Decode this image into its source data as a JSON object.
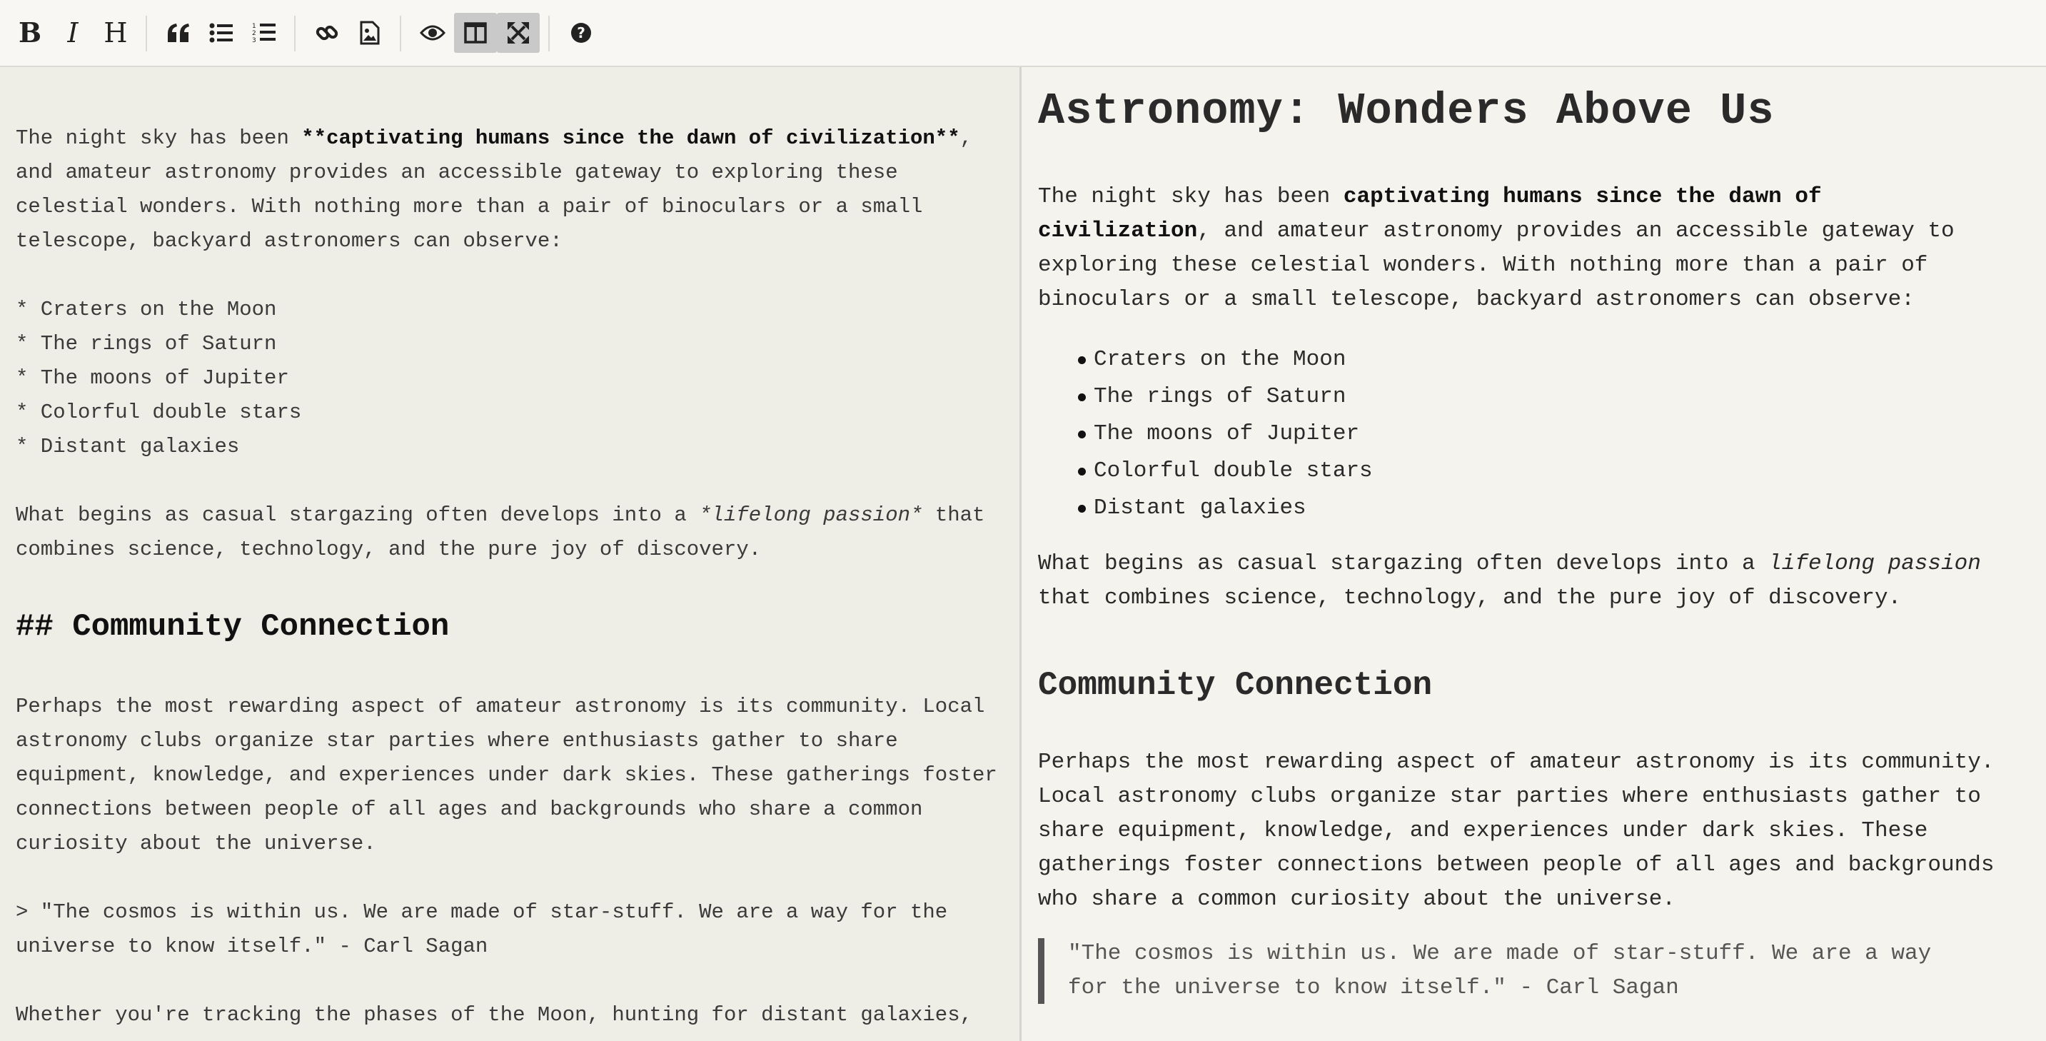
{
  "toolbar": {
    "buttons": [
      {
        "name": "bold",
        "label": "B"
      },
      {
        "name": "italic",
        "label": "I"
      },
      {
        "name": "heading",
        "label": "H"
      },
      {
        "name": "quote",
        "icon": "quote-icon"
      },
      {
        "name": "unordered-list",
        "icon": "unordered-list-icon"
      },
      {
        "name": "ordered-list",
        "icon": "ordered-list-icon"
      },
      {
        "name": "link",
        "icon": "link-icon"
      },
      {
        "name": "image",
        "icon": "image-icon"
      },
      {
        "name": "preview",
        "icon": "eye-icon"
      },
      {
        "name": "side-by-side",
        "icon": "columns-icon",
        "active": true
      },
      {
        "name": "fullscreen",
        "icon": "fullscreen-icon",
        "active": true
      },
      {
        "name": "guide",
        "icon": "help-icon"
      }
    ],
    "active_color": "#c9c9c9"
  },
  "editor": {
    "p1": [
      {
        "pre": "The night sky has been ",
        "bold": "**captivating humans since the dawn of civilization**",
        "post": ","
      },
      "and amateur astronomy provides an accessible gateway to exploring these",
      "celestial wonders. With nothing more than a pair of binoculars or a small",
      "telescope, backyard astronomers can observe:"
    ],
    "list": [
      "* Craters on the Moon",
      "* The rings of Saturn",
      "* The moons of Jupiter",
      "* Colorful double stars",
      "* Distant galaxies"
    ],
    "p2_line1_pre": "What begins as casual stargazing often develops into a ",
    "p2_line1_em": "*lifelong passion*",
    "p2_line1_post": " that",
    "p2_line2": "combines science, technology, and the pure joy of discovery.",
    "h2": "## Community Connection",
    "p3": [
      "Perhaps the most rewarding aspect of amateur astronomy is its community. Local",
      "astronomy clubs organize star parties where enthusiasts gather to share",
      "equipment, knowledge, and experiences under dark skies. These gatherings foster",
      "connections between people of all ages and backgrounds who share a common",
      "curiosity about the universe."
    ],
    "quote": [
      "> \"The cosmos is within us. We are made of star-stuff. We are a way for the",
      "universe to know itself.\" - Carl Sagan"
    ],
    "p4": "Whether you're tracking the phases of the Moon, hunting for distant galaxies,"
  },
  "preview": {
    "h1": "Astronomy: Wonders Above Us",
    "p1_line1_pre": "The night sky has been ",
    "p1_line1_bold": "captivating humans since the dawn of",
    "p1_line2_bold": "civilization",
    "p1_line2_post": ", and amateur astronomy provides an accessible gateway to",
    "p1_line3": "exploring these celestial wonders. With nothing more than a pair of",
    "p1_line4": "binoculars or a small telescope, backyard astronomers can observe:",
    "list": [
      "Craters on the Moon",
      "The rings of Saturn",
      "The moons of Jupiter",
      "Colorful double stars",
      "Distant galaxies"
    ],
    "p2_line1_pre": "What begins as casual stargazing often develops into a ",
    "p2_line1_em": "lifelong passion",
    "p2_line2": "that combines science, technology, and the pure joy of discovery.",
    "h2": "Community Connection",
    "p3": [
      "Perhaps the most rewarding aspect of amateur astronomy is its community.",
      "Local astronomy clubs organize star parties where enthusiasts gather to",
      "share equipment, knowledge, and experiences under dark skies. These",
      "gatherings foster connections between people of all ages and backgrounds",
      "who share a common curiosity about the universe."
    ],
    "quote": [
      "\"The cosmos is within us. We are made of star-stuff. We are a way",
      "for the universe to know itself.\" - Carl Sagan"
    ]
  }
}
